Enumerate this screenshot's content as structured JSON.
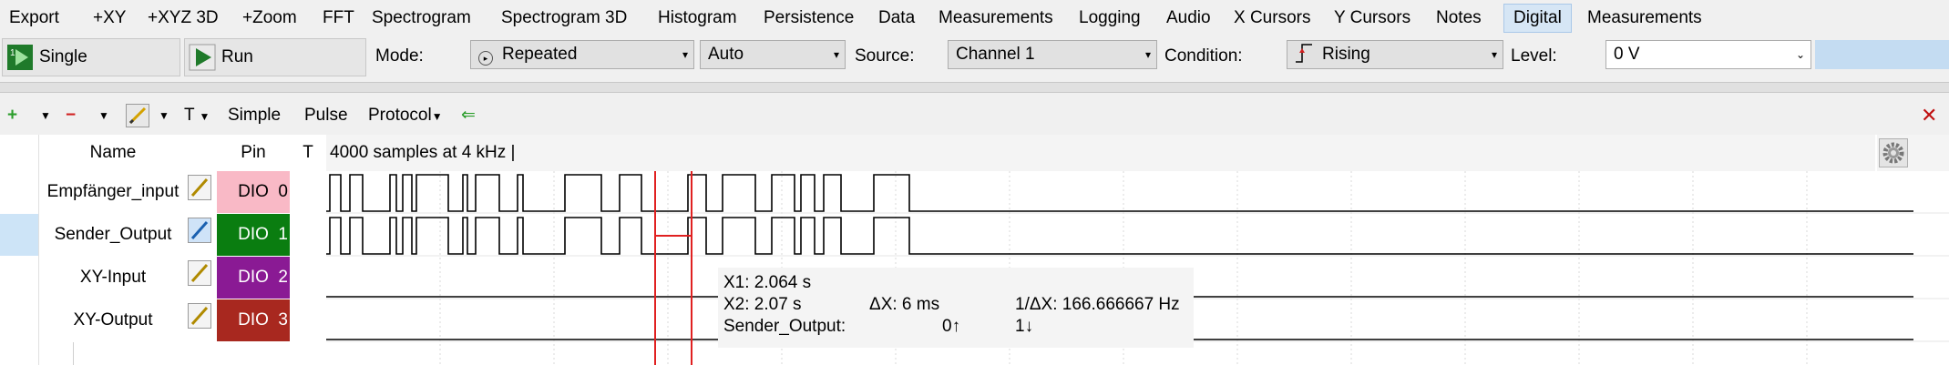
{
  "menu": {
    "items": [
      "Export",
      "+XY",
      "+XYZ 3D",
      "+Zoom",
      "FFT",
      "Spectrogram",
      "Spectrogram 3D",
      "Histogram",
      "Persistence",
      "Data",
      "Measurements",
      "Logging",
      "Audio",
      "X Cursors",
      "Y Cursors",
      "Notes",
      "Digital",
      "Measurements"
    ],
    "active_item": "Digital"
  },
  "toolbar": {
    "single_label": "Single",
    "run_label": "Run",
    "mode_label": "Mode:",
    "mode_value": "Repeated",
    "auto_value": "Auto",
    "source_label": "Source:",
    "source_value": "Channel 1",
    "condition_label": "Condition:",
    "condition_value": "Rising",
    "level_label": "Level:",
    "level_value": "0 V"
  },
  "digital_toolbar": {
    "t_label": "T",
    "simple_label": "Simple",
    "pulse_label": "Pulse",
    "protocol_label": "Protocol"
  },
  "table": {
    "headers": {
      "name": "Name",
      "pin": "Pin",
      "t": "T"
    },
    "info": "4000 samples at 4 kHz |",
    "rows": [
      {
        "name": "Empfänger_input",
        "pin": "DIO",
        "pin_num": "0",
        "pin_color": "#f9b9c6",
        "pin_text_color": "#000000"
      },
      {
        "name": "Sender_Output",
        "pin": "DIO",
        "pin_num": "1",
        "pin_color": "#0a7d10",
        "pin_text_color": "#ffffff"
      },
      {
        "name": "XY-Input",
        "pin": "DIO",
        "pin_num": "2",
        "pin_color": "#8a1a94",
        "pin_text_color": "#ffffff"
      },
      {
        "name": "XY-Output",
        "pin": "DIO",
        "pin_num": "3",
        "pin_color": "#a8281f",
        "pin_text_color": "#ffffff"
      }
    ]
  },
  "cursor_readout": {
    "x1": "X1: 2.064 s",
    "x2": "X2: 2.07 s",
    "dx": "ΔX: 6 ms",
    "inv_dx": "1/ΔX: 166.666667 Hz",
    "signal_label": "Sender_Output:",
    "x1_state": "0↑",
    "x2_state": "1↓"
  },
  "colors": {
    "cursor": "#e02020",
    "selected_row": "#cde4f7",
    "accent": "#c4dcf2"
  }
}
